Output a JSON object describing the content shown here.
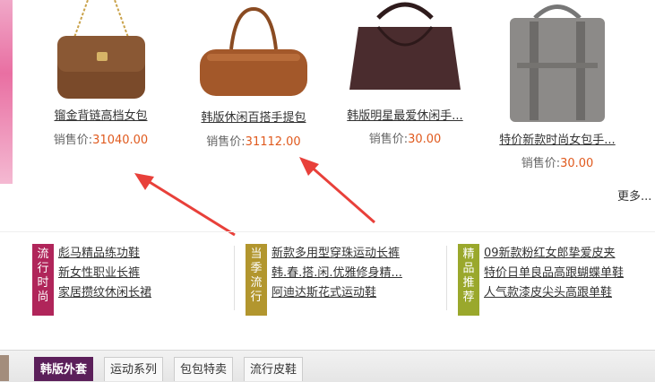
{
  "products": [
    {
      "name": "镏金背链高档女包",
      "price_label": "销售价:",
      "price": "31040.00"
    },
    {
      "name": "韩版休闲百搭手提包",
      "price_label": "销售价:",
      "price": "31112.00"
    },
    {
      "name": "韩版明星最爱休闲手...",
      "price_label": "销售价:",
      "price": "30.00"
    },
    {
      "name": "特价新款时尚女包手...",
      "price_label": "销售价:",
      "price": "30.00"
    }
  ],
  "more_label": "更多...",
  "categories": [
    {
      "tag": "流行时尚",
      "color": "#b0255a",
      "links": [
        "彪马精品练功鞋",
        "新女性职业长裤",
        "家居攒纹休闲长裙"
      ]
    },
    {
      "tag": "当季流行",
      "color": "#b2962e",
      "links": [
        "新款多用型穿珠运动长裤",
        "韩.春.搭.闲.优雅修身精...",
        "阿迪达斯花式运动鞋"
      ]
    },
    {
      "tag": "精品推荐",
      "color": "#9aa82c",
      "links": [
        "09新款粉红女郎挚爱皮夹",
        "特价日单良品高跟蝴蝶单鞋",
        "人气款漆皮尖头高跟单鞋"
      ]
    }
  ],
  "tabs": [
    "韩版外套",
    "运动系列",
    "包包特卖",
    "流行皮鞋"
  ],
  "colors": {
    "price": "#e05a1e",
    "arrow": "#e8403a",
    "active_tab": "#5b1f5a"
  }
}
